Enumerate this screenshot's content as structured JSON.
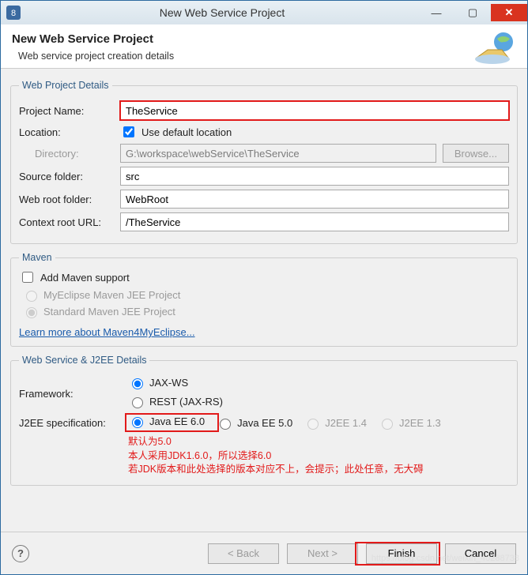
{
  "titlebar": {
    "title": "New Web Service Project"
  },
  "header": {
    "title": "New Web Service Project",
    "subtitle": "Web service project creation details"
  },
  "details": {
    "legend": "Web Project Details",
    "name_label": "Project Name:",
    "name_value": "TheService",
    "loc_label": "Location:",
    "loc_chk": "Use default location",
    "dir_label": "Directory:",
    "dir_value": "G:\\workspace\\webService\\TheService",
    "browse": "Browse...",
    "src_label": "Source folder:",
    "src_value": "src",
    "root_label": "Web root folder:",
    "root_value": "WebRoot",
    "ctx_label": "Context root URL:",
    "ctx_value": "/TheService"
  },
  "maven": {
    "legend": "Maven",
    "add": "Add Maven support",
    "opt1": "MyEclipse Maven JEE Project",
    "opt2": "Standard Maven JEE Project",
    "link": "Learn more about Maven4MyEclipse..."
  },
  "ws": {
    "legend": "Web Service & J2EE Details",
    "fw_label": "Framework:",
    "fw_opt1": "JAX-WS",
    "fw_opt2": "REST (JAX-RS)",
    "spec_label": "J2EE specification:",
    "ee6": "Java EE 6.0",
    "ee5": "Java EE 5.0",
    "j14": "J2EE 1.4",
    "j13": "J2EE 1.3",
    "note1": "默认为5.0",
    "note2": "本人采用JDK1.6.0，所以选择6.0",
    "note3": "若JDK版本和此处选择的版本对应不上，会提示；此处任意，无大碍"
  },
  "footer": {
    "back": "< Back",
    "next": "Next >",
    "finish": "Finish",
    "cancel": "Cancel"
  }
}
